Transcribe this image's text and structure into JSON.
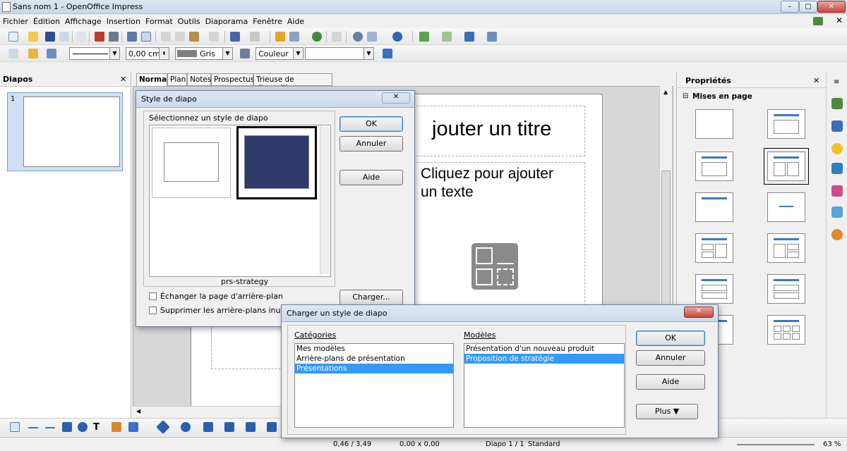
{
  "window": {
    "title": "Sans nom 1 - OpenOffice Impress"
  },
  "menubar": [
    "Fichier",
    "Édition",
    "Affichage",
    "Insertion",
    "Format",
    "Outils",
    "Diaporama",
    "Fenêtre",
    "Aide"
  ],
  "linebar": {
    "width_value": "0,00 cm",
    "color_name": "Gris",
    "fill_type": "Couleur"
  },
  "slides_panel": {
    "title": "Diapos",
    "slide_number": "1"
  },
  "view_tabs": [
    "Normal",
    "Plan",
    "Notes",
    "Prospectus",
    "Trieuse de diapositives"
  ],
  "slide": {
    "title_placeholder": "jouter un titre",
    "text_placeholder_1": "Cliquez pour ajouter",
    "text_placeholder_2": "un texte"
  },
  "properties_panel": {
    "title": "Propriétés",
    "section": "Mises en page"
  },
  "status": {
    "position": "0,46 / 3,49",
    "size": "0,00 x 0,00",
    "slide_info": "Diapo 1 / 1",
    "master": "Standard",
    "zoom": "63 %"
  },
  "style_dialog": {
    "title": "Style de diapo",
    "select_label": "Sélectionnez un style de diapo",
    "caption": "prs-strategy",
    "ok": "OK",
    "cancel": "Annuler",
    "help": "Aide",
    "load": "Charger...",
    "exchange_bg": "Échanger la page d'arrière-plan",
    "delete_unused": "Supprimer les arrière-plans inutilisés"
  },
  "load_dialog": {
    "title": "Charger un style de diapo",
    "categories_label": "Catégories",
    "templates_label": "Modèles",
    "categories": [
      "Mes modèles",
      "Arrière-plans de présentation",
      "Présentations"
    ],
    "templates": [
      "Présentation d'un nouveau produit",
      "Proposition de stratégie"
    ],
    "ok": "OK",
    "cancel": "Annuler",
    "help": "Aide",
    "more": "Plus"
  },
  "colors": {
    "selection": "#3399ff",
    "layout_bar": "#3a78c2",
    "template_dark": "#2f3a6a"
  }
}
